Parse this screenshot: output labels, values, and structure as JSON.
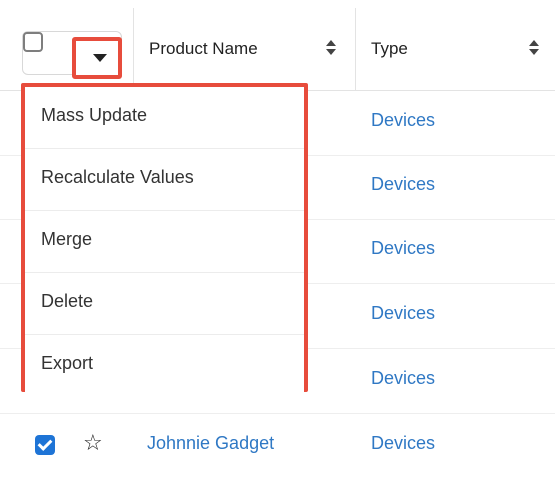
{
  "header": {
    "columns": [
      {
        "label": "Product Name"
      },
      {
        "label": "Type"
      }
    ]
  },
  "menu": {
    "items": [
      {
        "label": "Mass Update"
      },
      {
        "label": "Recalculate Values"
      },
      {
        "label": "Merge"
      },
      {
        "label": "Delete"
      },
      {
        "label": "Export"
      }
    ]
  },
  "rows": [
    {
      "name": "",
      "type": "Devices",
      "checked": false
    },
    {
      "name": "",
      "type": "Devices",
      "checked": false
    },
    {
      "name": "",
      "type": "Devices",
      "checked": false
    },
    {
      "name": "",
      "type": "Devices",
      "checked": false
    },
    {
      "name": "",
      "type": "Devices",
      "checked": false
    },
    {
      "name": "Johnnie Gadget",
      "type": "Devices",
      "checked": true
    }
  ],
  "icons": {
    "star": "☆",
    "caret": "caret-down-icon"
  },
  "colors": {
    "highlight": "#e74c3c",
    "link": "#2f78c4",
    "checked": "#1e74d6"
  }
}
